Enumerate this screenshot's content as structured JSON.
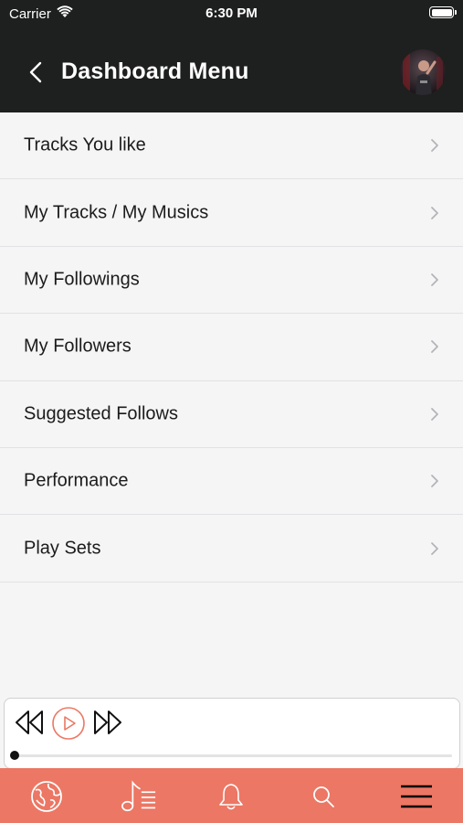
{
  "status_bar": {
    "carrier": "Carrier",
    "time": "6:30 PM",
    "wifi_icon": "wifi-icon",
    "battery_icon": "battery-icon",
    "battery_level": 1.0
  },
  "header": {
    "title": "Dashboard Menu",
    "back_icon": "chevron-left-icon",
    "avatar_icon": "user-avatar",
    "background_color": "#1e201f"
  },
  "menu": {
    "items": [
      {
        "label": "Tracks You like"
      },
      {
        "label": "My Tracks / My Musics"
      },
      {
        "label": "My Followings"
      },
      {
        "label": "My Followers"
      },
      {
        "label": "Suggested Follows"
      },
      {
        "label": "Performance"
      },
      {
        "label": "Play Sets"
      }
    ],
    "chevron_icon": "chevron-right-icon"
  },
  "player": {
    "rewind_icon": "rewind-icon",
    "play_icon": "play-circle-icon",
    "forward_icon": "fast-forward-icon",
    "progress": 0.0,
    "accent_color": "#ec7764"
  },
  "tabbar": {
    "background_color": "#ec7764",
    "tabs": [
      {
        "icon": "globe-icon"
      },
      {
        "icon": "music-list-icon"
      },
      {
        "icon": "bell-icon"
      },
      {
        "icon": "search-icon"
      },
      {
        "icon": "hamburger-menu-icon"
      }
    ]
  }
}
